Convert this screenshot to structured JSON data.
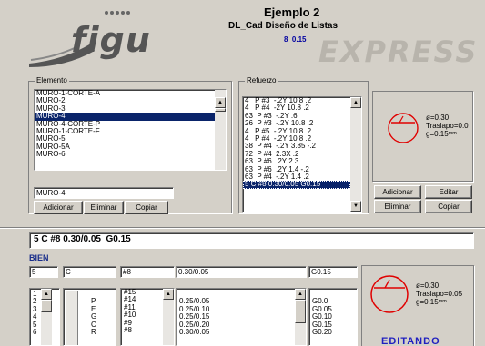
{
  "header": {
    "logo_text": "figu",
    "title": "Ejemplo 2",
    "subtitle": "DL_Cad Diseño de Listas",
    "version": "8  0.15",
    "watermark": "EXPRESS"
  },
  "elemento": {
    "label": "Elemento",
    "items": [
      "MURO-1-CORTE-A",
      "MURO-2",
      "MURO-3",
      "MURO-4",
      "MURO-4-CORTE-P",
      "MURO-1-CORTE-F",
      "MURO-5",
      "MURO-5A",
      "MURO-6"
    ],
    "selected_index": 3,
    "input_value": "MURO-4",
    "buttons": {
      "add": "Adicionar",
      "delete": "Eliminar",
      "copy": "Copiar"
    }
  },
  "refuerzo": {
    "label": "Refuerzo",
    "items": [
      "4   P #3  -.2Y 10.8 .2",
      "4   P #4  -2Y 10.8 .2",
      "63  P #3  -.2Y .6",
      "26  P #3  -.2Y 10.8 .2",
      "4   P #5  -.2Y 10.8 .2",
      "4   P #4  -.2Y 10.8 .2",
      "38  P #4  -.2Y 3.85 -.2",
      "72  P #4  2.3X .2",
      "63  P #6  .2Y 2.3",
      "63  P #6  .2Y 1.4 -.2",
      "63  P #4  -.2Y 1.4 .2",
      "5 C #8 0.30/0.05 G0.15"
    ],
    "selected_index": 11
  },
  "preview_top": {
    "diameter": "ø=0.30",
    "traslapo": "Traslapo=0.0",
    "gancho": "g=0.15ᵐᵐ"
  },
  "preview_buttons": {
    "add": "Adicionar",
    "edit": "Editar",
    "delete": "Eliminar",
    "copy": "Copiar"
  },
  "edit_line": {
    "value": "5 C #8 0.30/0.05  G0.15"
  },
  "status": {
    "text": "BIEN"
  },
  "fields": {
    "qty": "5",
    "type": "C",
    "bar": "#8",
    "spacing": "0.30/0.05",
    "hook": "G0.15"
  },
  "bottom_lists": {
    "numbers": [
      "1",
      "2",
      "3",
      "4",
      "5",
      "6"
    ],
    "types": [
      "",
      "P",
      "E",
      "G",
      "C",
      "R"
    ],
    "bars": [
      "#15",
      "#14",
      "#11",
      "#10",
      "#9",
      "#8"
    ],
    "spacings": [
      "",
      "0.25/0.05",
      "0.25/0.10",
      "0.25/0.15",
      "0.25/0.20",
      "0.30/0.05"
    ],
    "hooks": [
      "",
      "G0.0",
      "G0.05",
      "G0.10",
      "G0.15",
      "G0.20"
    ]
  },
  "preview_bottom": {
    "diameter": "ø=0.30",
    "traslapo": "Traslapo=0.05",
    "gancho": "g=0.15ᵐᵐ",
    "editing_label": "EDITANDO"
  }
}
